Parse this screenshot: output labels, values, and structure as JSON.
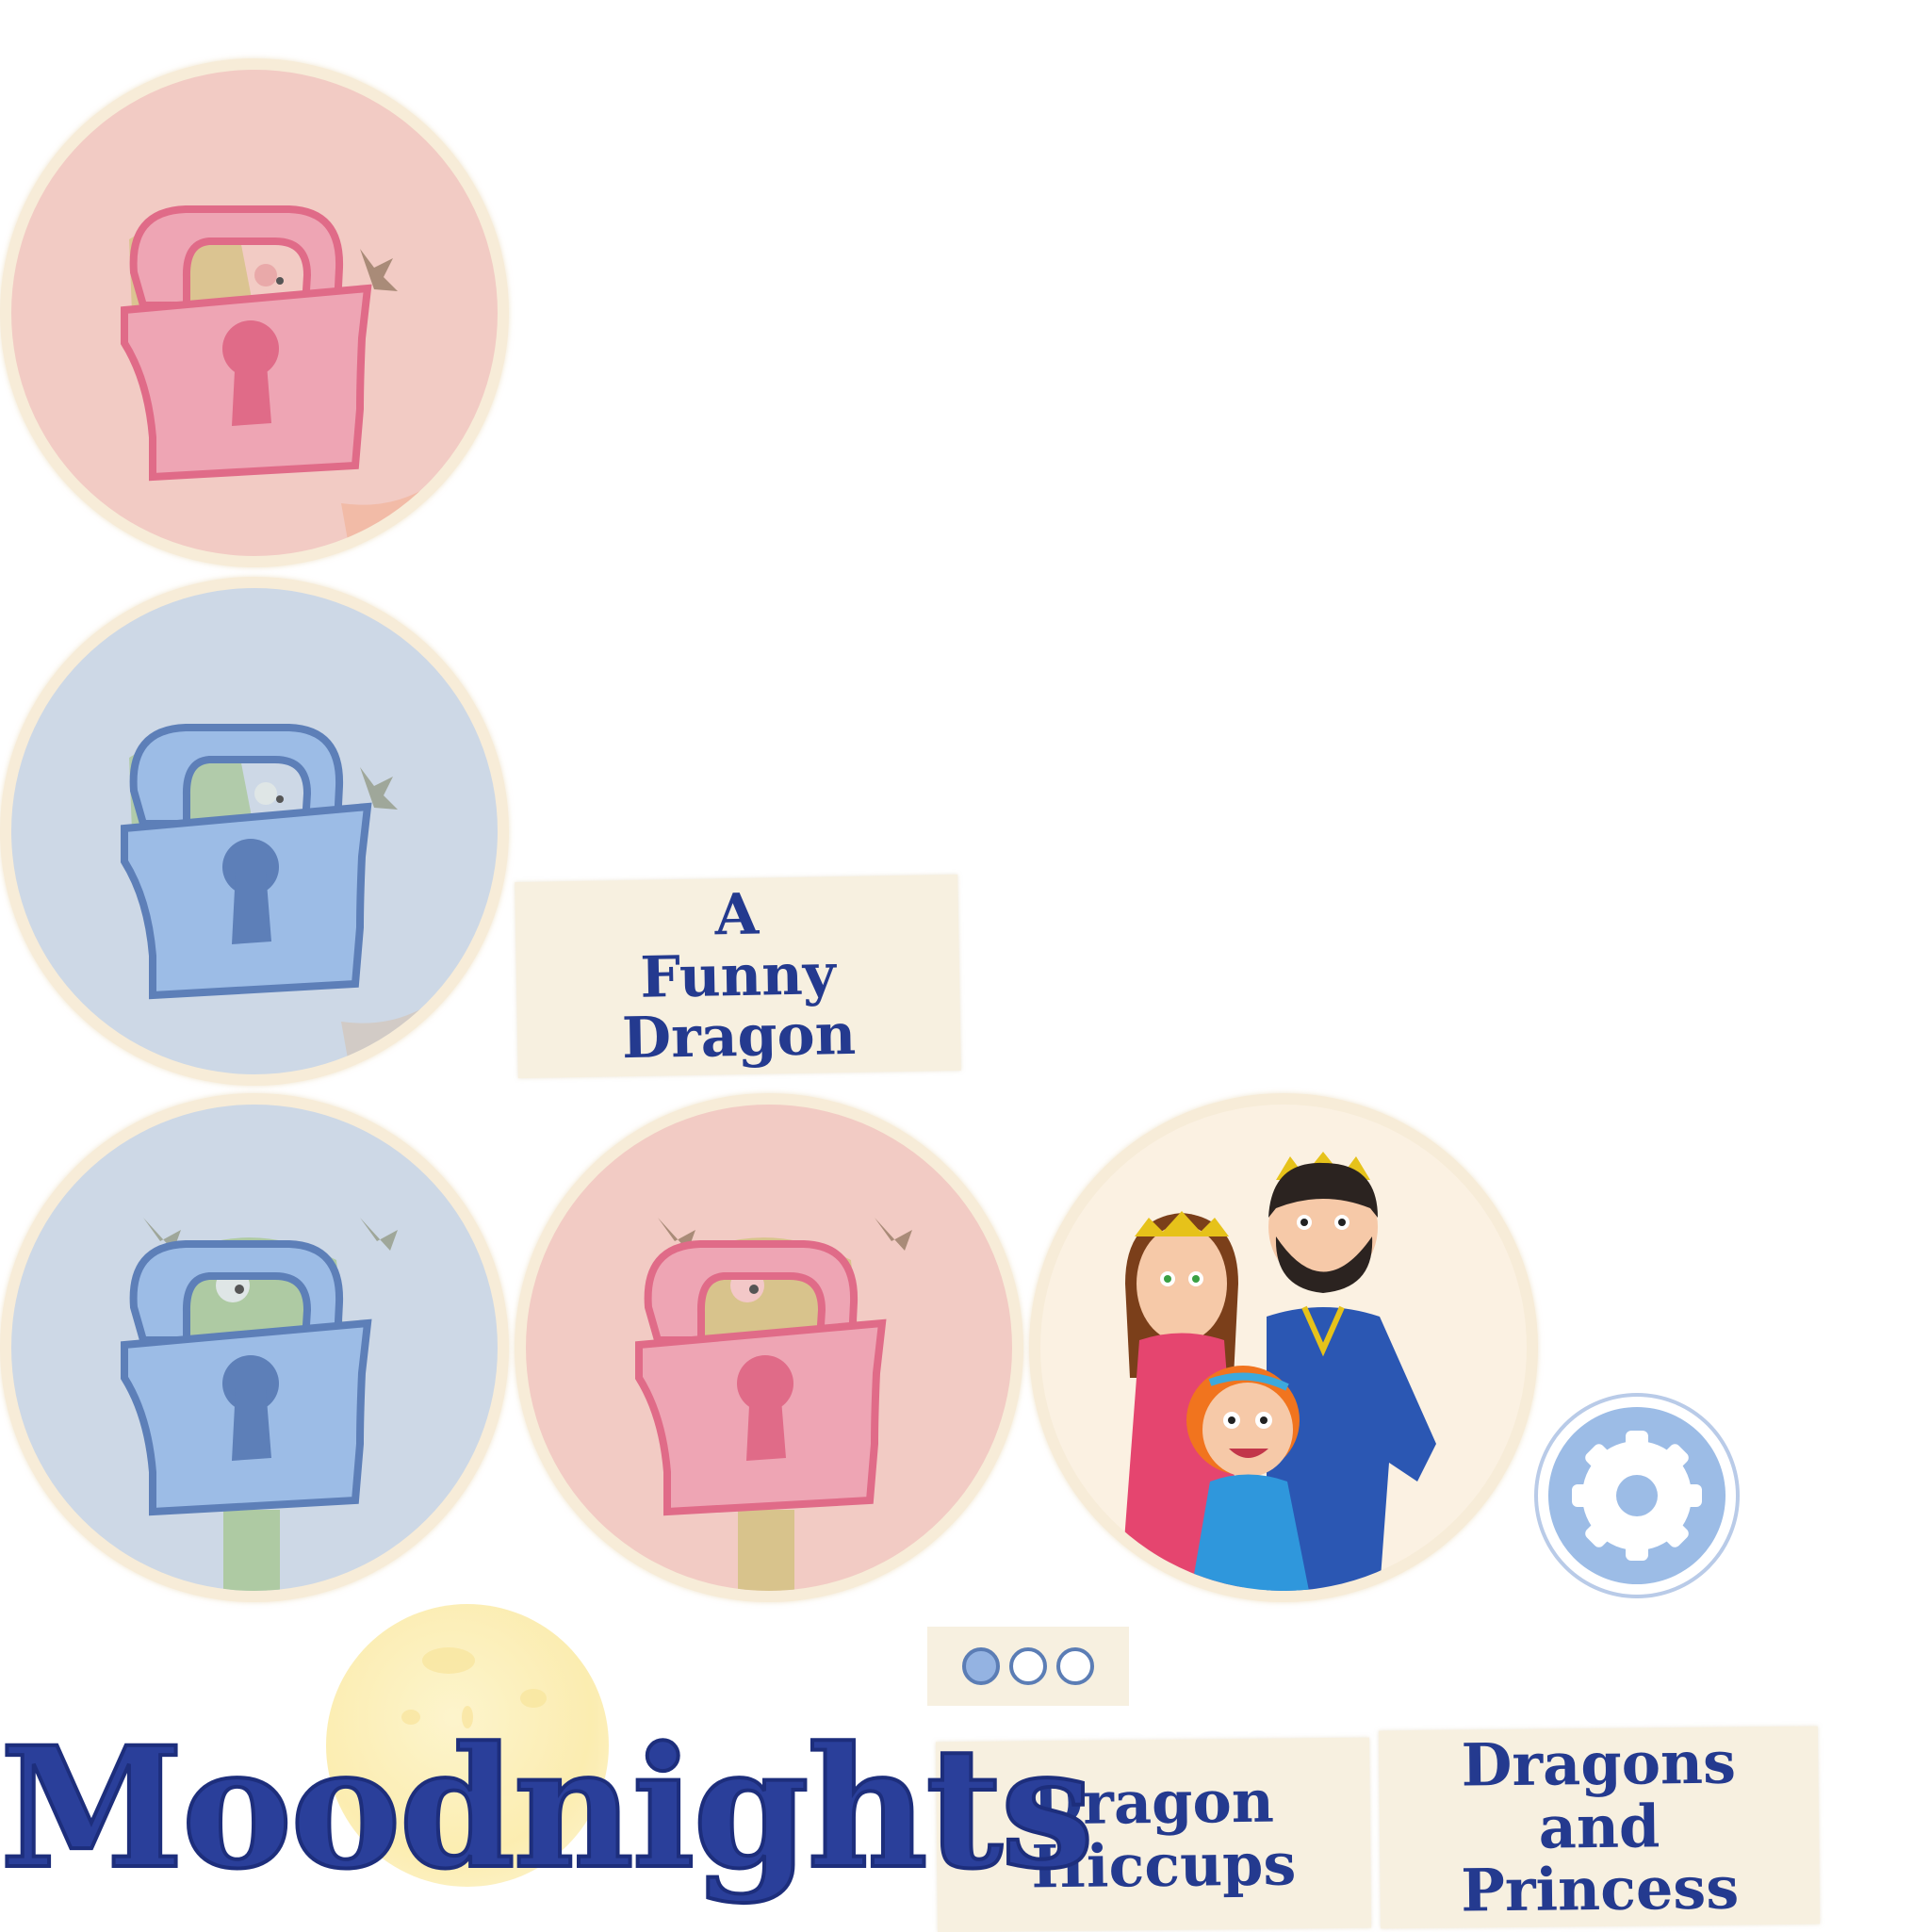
{
  "brand": {
    "title": "Moodnights"
  },
  "stories": [
    {
      "title": "A Funny Dragon"
    },
    {
      "title": "Dragon Hiccups"
    },
    {
      "title": "Dragons and Princess"
    }
  ],
  "tiles": [
    {
      "state": "locked",
      "color": "pink",
      "icon": "lock-icon"
    },
    {
      "state": "locked",
      "color": "blue",
      "icon": "lock-icon"
    },
    {
      "state": "locked",
      "color": "blue",
      "icon": "lock-icon"
    },
    {
      "state": "locked",
      "color": "pink",
      "icon": "lock-icon"
    },
    {
      "state": "unlocked",
      "color": "cream",
      "icon": "royal-family-illustration"
    }
  ],
  "pager": {
    "pages": 3,
    "active": 1
  },
  "settings": {
    "icon": "gear-icon"
  },
  "colors": {
    "title_blue": "#2a3f9a",
    "lock_pink": "#eea5b4",
    "lock_blue": "#9cbce6",
    "paper": "#f7f0e0"
  }
}
